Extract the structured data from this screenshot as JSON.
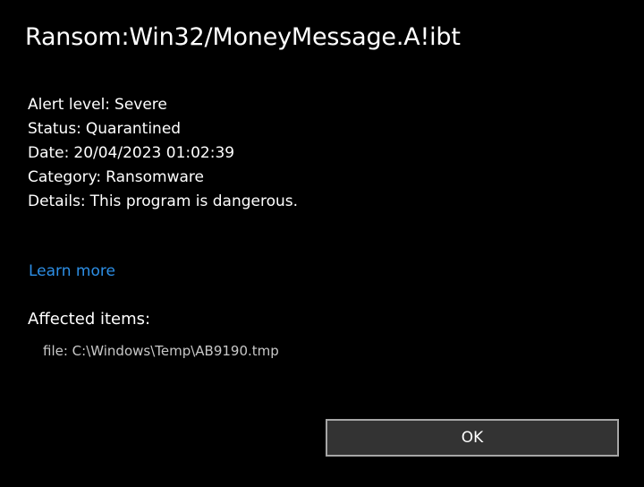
{
  "dialog": {
    "title": "Ransom:Win32/MoneyMessage.A!ibt"
  },
  "details": [
    {
      "label": "Alert level:",
      "value": "Severe"
    },
    {
      "label": "Status:",
      "value": "Quarantined"
    },
    {
      "label": "Date:",
      "value": "20/04/2023 01:02:39"
    },
    {
      "label": "Category:",
      "value": "Ransomware"
    },
    {
      "label": "Details:",
      "value": "This program is dangerous."
    }
  ],
  "learn_more": {
    "label": "Learn more"
  },
  "affected": {
    "heading": "Affected items:",
    "items": [
      "file: C:\\Windows\\Temp\\AB9190.tmp"
    ]
  },
  "buttons": {
    "ok_label": "OK"
  },
  "colors": {
    "background": "#000000",
    "link": "#2d8fe6",
    "button_fill": "#333333",
    "button_border": "#a6a6a6"
  }
}
